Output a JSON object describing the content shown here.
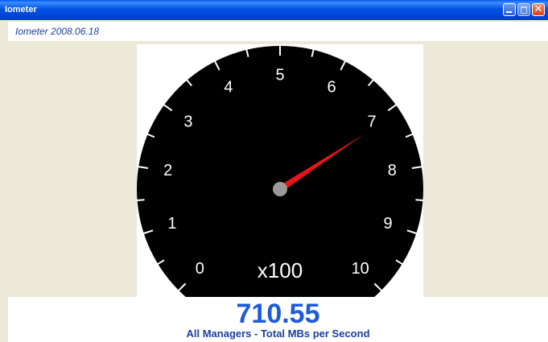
{
  "window": {
    "title": "Iometer",
    "controls": [
      "minimize-icon",
      "maximize-icon",
      "close-icon"
    ],
    "close_glyph": "✕"
  },
  "header": {
    "version_text": "Iometer 2008.06.18"
  },
  "gauge": {
    "scale_labels": [
      "0",
      "1",
      "2",
      "3",
      "4",
      "5",
      "6",
      "7",
      "8",
      "9",
      "10"
    ],
    "multiplier_label": "x100",
    "scale_min": 0,
    "scale_max": 1000,
    "needle_value": 710.55,
    "dial_color": "#000000",
    "needle_color": "#e8141c",
    "hub_color": "#9a9a9a"
  },
  "readout": {
    "value": "710.55",
    "caption": "All Managers - Total MBs per Second",
    "value_color": "#1e5bd6"
  }
}
